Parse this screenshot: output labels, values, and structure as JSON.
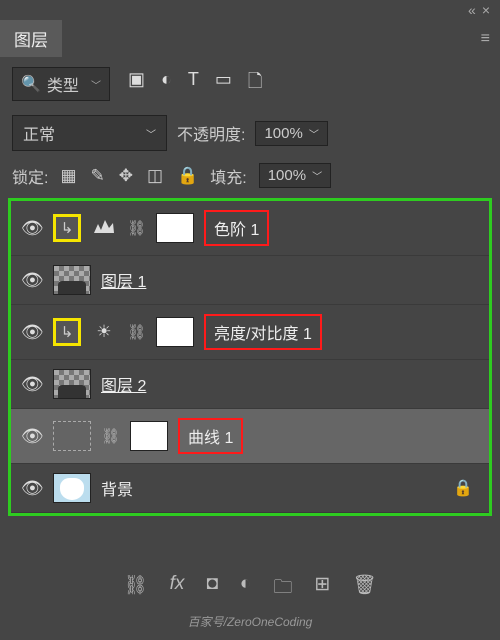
{
  "header": {
    "collapse": "«",
    "close": "×"
  },
  "panel": {
    "title": "图层"
  },
  "filter": {
    "search_label": "类型"
  },
  "blend": {
    "mode": "正常",
    "opacity_label": "不透明度:",
    "opacity_value": "100%"
  },
  "lock": {
    "label": "锁定:",
    "fill_label": "填充:",
    "fill_value": "100%"
  },
  "layers": [
    {
      "name": "色阶 1"
    },
    {
      "name": "图层 1"
    },
    {
      "name": "亮度/对比度 1"
    },
    {
      "name": "图层 2"
    },
    {
      "name": "曲线 1"
    },
    {
      "name": "背景"
    }
  ],
  "watermark": "百家号/ZeroOneCoding"
}
